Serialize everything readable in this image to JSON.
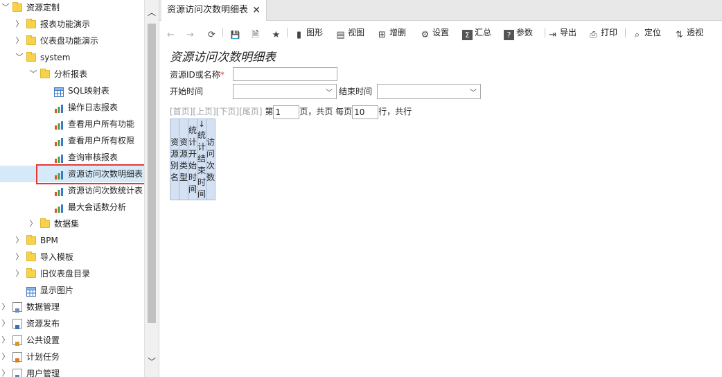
{
  "sidebar": {
    "items": [
      {
        "label": "资源定制",
        "icon": "folder-icon",
        "arrow": "down"
      },
      {
        "label": "报表功能演示",
        "icon": "folder-icon",
        "arrow": "right"
      },
      {
        "label": "仪表盘功能演示",
        "icon": "folder-icon",
        "arrow": "right"
      },
      {
        "label": "system",
        "icon": "folder-icon",
        "arrow": "down"
      },
      {
        "label": "分析报表",
        "icon": "folder-icon",
        "arrow": "down"
      },
      {
        "label": "SQL映射表",
        "icon": "grid-report-icon"
      },
      {
        "label": "操作日志报表",
        "icon": "bar-chart-icon"
      },
      {
        "label": "查看用户所有功能",
        "icon": "bar-chart-icon"
      },
      {
        "label": "查看用户所有权限",
        "icon": "bar-chart-icon"
      },
      {
        "label": "查询审核报表",
        "icon": "bar-chart-icon"
      },
      {
        "label": "资源访问次数明细表",
        "icon": "bar-chart-icon",
        "selected": true
      },
      {
        "label": "资源访问次数统计表",
        "icon": "bar-chart-icon"
      },
      {
        "label": "最大会话数分析",
        "icon": "bar-chart-icon"
      },
      {
        "label": "数据集",
        "icon": "folder-icon",
        "arrow": "right"
      },
      {
        "label": "BPM",
        "icon": "folder-icon",
        "arrow": "right"
      },
      {
        "label": "导入模板",
        "icon": "folder-icon",
        "arrow": "right"
      },
      {
        "label": "旧仪表盘目录",
        "icon": "folder-icon",
        "arrow": "right"
      },
      {
        "label": "显示图片",
        "icon": "grid-report-icon"
      },
      {
        "label": "数据管理",
        "icon": "data-doc-icon",
        "arrow": "right"
      },
      {
        "label": "资源发布",
        "icon": "publish-doc-icon",
        "arrow": "right"
      },
      {
        "label": "公共设置",
        "icon": "settings-doc-icon",
        "arrow": "right"
      },
      {
        "label": "计划任务",
        "icon": "schedule-doc-icon",
        "arrow": "right"
      },
      {
        "label": "用户管理",
        "icon": "user-doc-icon",
        "arrow": "right"
      }
    ]
  },
  "tab": {
    "label": "资源访问次数明细表",
    "close": "✕"
  },
  "toolbar": {
    "icons": {
      "back": "←",
      "forward": "→",
      "refresh": "⟳",
      "save": "💾",
      "save_as": "🗎",
      "favorite": "★"
    },
    "buttons": [
      {
        "label": "图形",
        "icon": "chart-icon",
        "glyph": "▮"
      },
      {
        "label": "视图",
        "icon": "view-icon",
        "glyph": "▤"
      },
      {
        "label": "增删",
        "icon": "add-delete-icon",
        "glyph": "⊞"
      },
      {
        "label": "设置",
        "icon": "settings-icon",
        "glyph": "⚙"
      },
      {
        "label": "汇总",
        "icon": "summary-icon",
        "glyph": "Σ"
      },
      {
        "label": "参数",
        "icon": "parameter-icon",
        "glyph": "?"
      },
      {
        "label": "导出",
        "icon": "export-icon",
        "glyph": "⇥"
      },
      {
        "label": "打印",
        "icon": "print-icon",
        "glyph": "⎙"
      },
      {
        "label": "定位",
        "icon": "locate-icon",
        "glyph": "⌕"
      },
      {
        "label": "透视",
        "icon": "pivot-icon",
        "glyph": "⇅"
      }
    ]
  },
  "report": {
    "title": "资源访问次数明细表",
    "filters": {
      "resource_label": "资源ID或名称",
      "required_mark": "*",
      "resource_value": "",
      "start_label": "开始时间",
      "start_value": "",
      "end_label": "结束时间",
      "end_value": ""
    },
    "pager": {
      "first": "[首页]",
      "prev": "[上页]",
      "next": "[下页]",
      "last": "[尾页]",
      "page_prefix": "第",
      "page_value": "1",
      "page_suffix": "页，共页 每页",
      "per_page_value": "10",
      "per_page_suffix": "行，共行"
    },
    "columns": [
      "资源别名",
      "资源类型",
      "统计开始时间",
      "↓统计结束时间",
      "访问次数"
    ]
  }
}
